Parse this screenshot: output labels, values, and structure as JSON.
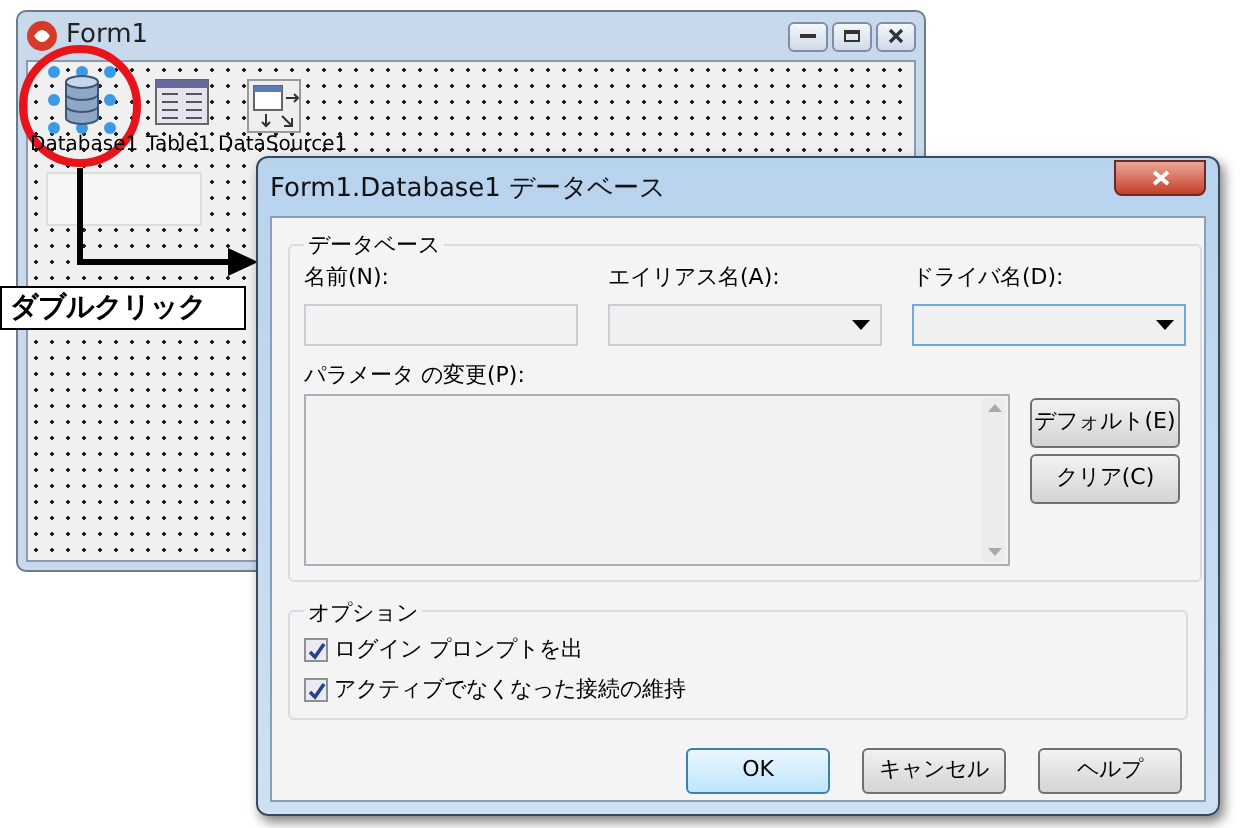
{
  "form_window": {
    "title": "Form1",
    "components": [
      {
        "kind": "database",
        "label": "Database1"
      },
      {
        "kind": "table",
        "label": "Table1"
      },
      {
        "kind": "datasource",
        "label": "DataSource1"
      }
    ]
  },
  "callout": {
    "text": "ダブルクリック"
  },
  "dialog": {
    "title": "Form1.Database1 データベース",
    "database_group": {
      "legend": "データベース",
      "fields": [
        {
          "kind": "text",
          "label": "名前(N):",
          "focused": false
        },
        {
          "kind": "combo",
          "label": "エイリアス名(A):",
          "focused": false
        },
        {
          "kind": "combo",
          "label": "ドライバ名(D):",
          "focused": true
        }
      ],
      "parameters": {
        "label": "パラメータ の変更(P):"
      },
      "buttons": [
        "デフォルト(E)",
        "クリア(C)"
      ]
    },
    "options_group": {
      "legend": "オプション",
      "options": [
        {
          "label": "ログイン プロンプトを出",
          "checked": true
        },
        {
          "label": "アクティブでなくなった接続の維持",
          "checked": true
        }
      ]
    },
    "buttons": [
      {
        "label": "OK",
        "default": true
      },
      {
        "label": "キャンセル",
        "default": false
      },
      {
        "label": "ヘルプ",
        "default": false
      }
    ]
  }
}
